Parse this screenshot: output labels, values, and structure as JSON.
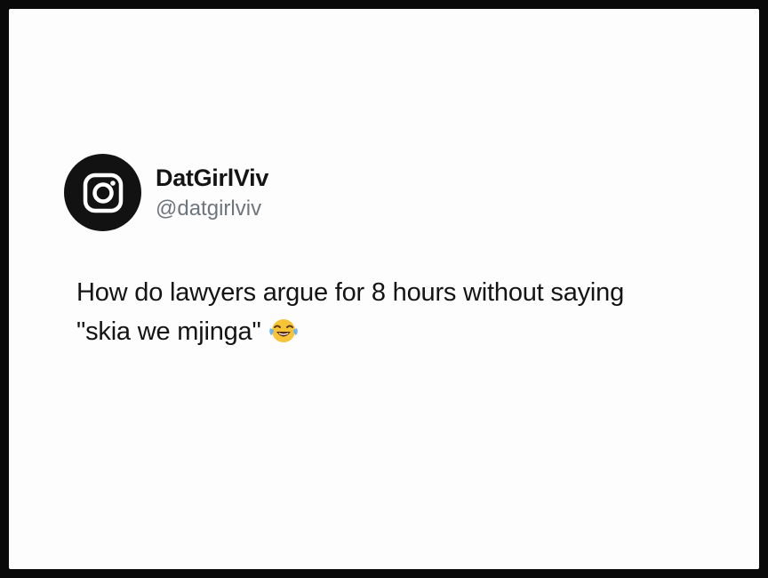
{
  "tweet": {
    "author": {
      "display_name": "DatGirlViv",
      "handle": "@datgirlviv",
      "avatar_icon": "instagram-logo-icon"
    },
    "text_lines": [
      "How do lawyers argue for 8 hours without saying",
      "\"skia we mjinga\""
    ],
    "emoji": "face-with-tears-of-joy-icon"
  },
  "colors": {
    "background_border": "#0a0a0a",
    "card": "#fdfdfd",
    "avatar_bg": "#121212",
    "text": "#141414",
    "handle": "#6e767d"
  }
}
